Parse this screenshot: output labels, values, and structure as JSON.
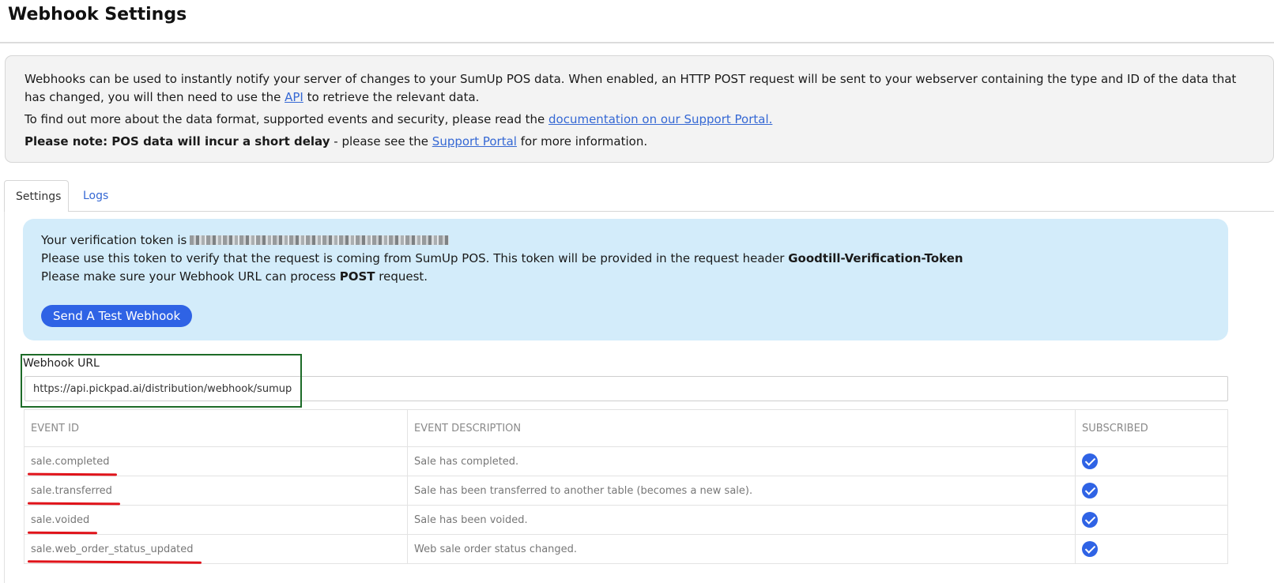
{
  "page": {
    "title": "Webhook Settings"
  },
  "info": {
    "p1_before": "Webhooks can be used to instantly notify your server of changes to your SumUp POS data. When enabled, an HTTP POST request will be sent to your webserver containing the type and ID of the data that has changed, you will then need to use the ",
    "p1_link": "API",
    "p1_after": " to retrieve the relevant data.",
    "p2_before": "To find out more about the data format, supported events and security, please read the ",
    "p2_link": "documentation on our Support Portal.",
    "p3_bold": "Please note: POS data will incur a short delay",
    "p3_mid": " - please see the ",
    "p3_link": "Support Portal",
    "p3_after": " for more information."
  },
  "tabs": [
    {
      "label": "Settings",
      "active": true
    },
    {
      "label": "Logs",
      "active": false
    }
  ],
  "token_box": {
    "line1": "Your verification token is",
    "line2_before": "Please use this token to verify that the request is coming from SumUp POS. This token will be provided in the request header ",
    "line2_bold": "Goodtill-Verification-Token",
    "line3_before": "Please make sure your Webhook URL can process ",
    "line3_bold": "POST",
    "line3_after": " request.",
    "button_label": "Send A Test Webhook"
  },
  "webhook_url": {
    "label": "Webhook URL",
    "value": "https://api.pickpad.ai/distribution/webhook/sumup"
  },
  "events_table": {
    "headers": [
      "EVENT ID",
      "EVENT DESCRIPTION",
      "SUBSCRIBED"
    ],
    "rows": [
      {
        "id": "sale.completed",
        "description": "Sale has completed.",
        "subscribed": true
      },
      {
        "id": "sale.transferred",
        "description": "Sale has been transferred to another table (becomes a new sale).",
        "subscribed": true
      },
      {
        "id": "sale.voided",
        "description": "Sale has been voided.",
        "subscribed": true
      },
      {
        "id": "sale.web_order_status_updated",
        "description": "Web sale order status changed.",
        "subscribed": true
      }
    ]
  },
  "colors": {
    "accent": "#2f63e5",
    "link": "#3568d4",
    "token_bg": "#d3ecfa",
    "annotation_red": "#e0131a",
    "annotation_green": "#1d6b28"
  }
}
